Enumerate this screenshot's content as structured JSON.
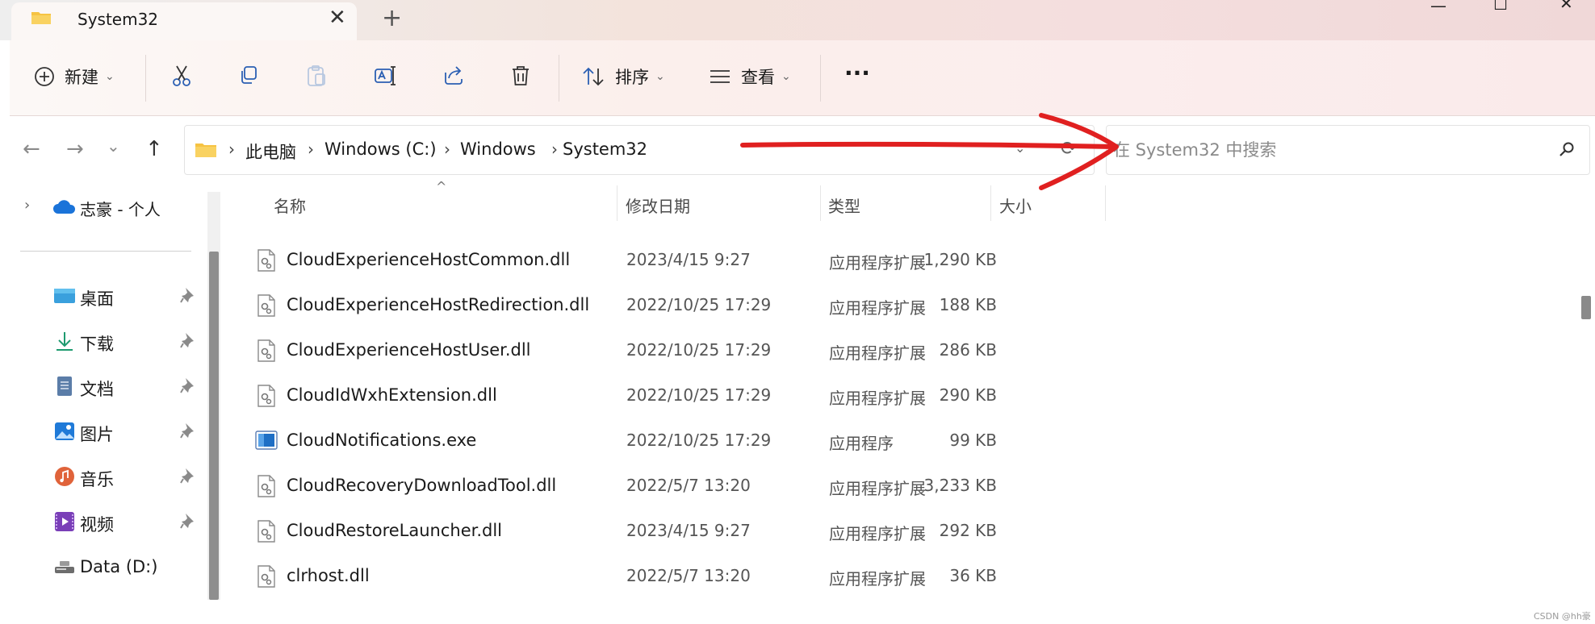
{
  "window": {
    "tab_title": "System32",
    "tab_close_glyph": "✕",
    "new_tab_glyph": "+",
    "minimize_glyph": "—",
    "maximize_glyph": "☐",
    "close_glyph": "✕"
  },
  "toolbar": {
    "new_label": "新建",
    "sort_label": "排序",
    "view_label": "查看",
    "more_label": "···",
    "chevron": "⌄",
    "icons": [
      "plus-circle-icon",
      "cut-icon",
      "copy-icon",
      "paste-icon",
      "rename-icon",
      "share-icon",
      "delete-icon",
      "sort-icon",
      "view-icon",
      "more-icon"
    ]
  },
  "nav": {
    "back_glyph": "←",
    "forward_glyph": "→",
    "recent_glyph": "⌄",
    "up_glyph": "↑"
  },
  "address": {
    "sep": "›",
    "crumbs": [
      "此电脑",
      "Windows (C:)",
      "Windows",
      "System32"
    ],
    "dropdown_glyph": "⌄",
    "refresh_glyph": "⟳"
  },
  "search": {
    "placeholder": "在 System32 中搜索",
    "value": ""
  },
  "sidebar": {
    "expander_glyph": "›",
    "onedrive_label": "志豪 - 个人",
    "items": [
      {
        "label": "桌面",
        "icon": "desktop-icon",
        "pinned": true
      },
      {
        "label": "下载",
        "icon": "download-icon",
        "pinned": true
      },
      {
        "label": "文档",
        "icon": "documents-icon",
        "pinned": true
      },
      {
        "label": "图片",
        "icon": "pictures-icon",
        "pinned": true
      },
      {
        "label": "音乐",
        "icon": "music-icon",
        "pinned": true
      },
      {
        "label": "视频",
        "icon": "videos-icon",
        "pinned": true
      },
      {
        "label": "Data (D:)",
        "icon": "drive-icon",
        "pinned": false
      }
    ]
  },
  "columns": {
    "name": "名称",
    "date": "修改日期",
    "type": "类型",
    "size": "大小",
    "sort_glyph": "^"
  },
  "files": [
    {
      "name": "CloudExperienceHostCommon.dll",
      "date": "2023/4/15 9:27",
      "type": "应用程序扩展",
      "size": "1,290 KB",
      "kind": "dll"
    },
    {
      "name": "CloudExperienceHostRedirection.dll",
      "date": "2022/10/25 17:29",
      "type": "应用程序扩展",
      "size": "188 KB",
      "kind": "dll"
    },
    {
      "name": "CloudExperienceHostUser.dll",
      "date": "2022/10/25 17:29",
      "type": "应用程序扩展",
      "size": "286 KB",
      "kind": "dll"
    },
    {
      "name": "CloudIdWxhExtension.dll",
      "date": "2022/10/25 17:29",
      "type": "应用程序扩展",
      "size": "290 KB",
      "kind": "dll"
    },
    {
      "name": "CloudNotifications.exe",
      "date": "2022/10/25 17:29",
      "type": "应用程序",
      "size": "99 KB",
      "kind": "exe"
    },
    {
      "name": "CloudRecoveryDownloadTool.dll",
      "date": "2022/5/7 13:20",
      "type": "应用程序扩展",
      "size": "3,233 KB",
      "kind": "dll"
    },
    {
      "name": "CloudRestoreLauncher.dll",
      "date": "2023/4/15 9:27",
      "type": "应用程序扩展",
      "size": "292 KB",
      "kind": "dll"
    },
    {
      "name": "clrhost.dll",
      "date": "2022/5/7 13:20",
      "type": "应用程序扩展",
      "size": "36 KB",
      "kind": "dll"
    }
  ],
  "watermark": "CSDN @hh豪",
  "colors": {
    "annotation_arrow": "#e02020",
    "folder": "#f6c343",
    "onedrive": "#1a73d9"
  }
}
